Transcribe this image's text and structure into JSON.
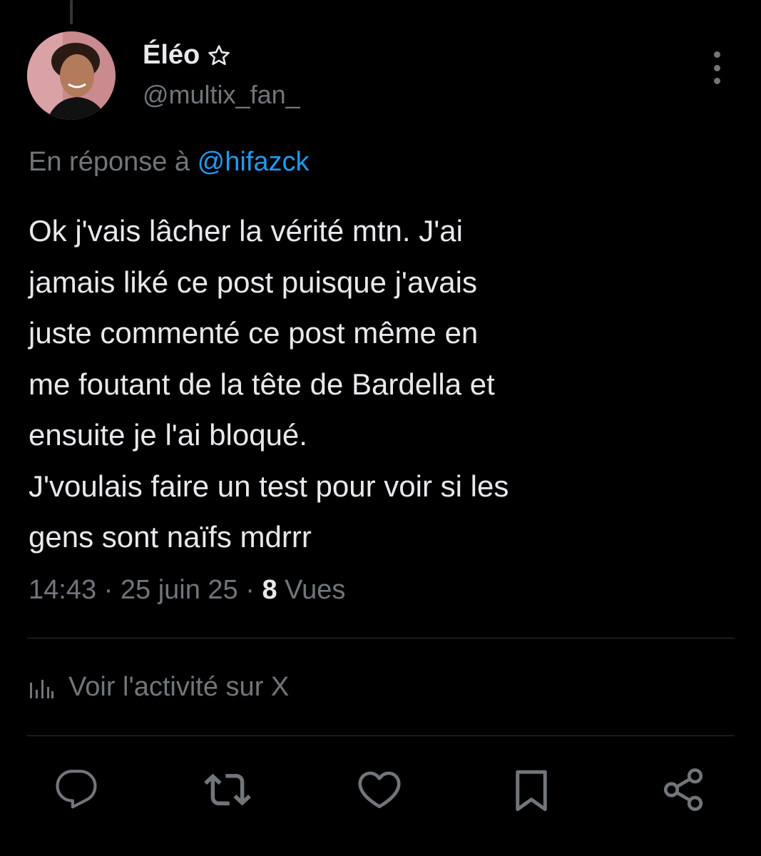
{
  "author": {
    "display_name": "Éléo",
    "handle": "@multix_fan_"
  },
  "reply_to": {
    "prefix": "En réponse à",
    "mention": "@hifazck"
  },
  "tweet": {
    "lines": [
      "Ok j'vais lâcher la vérité mtn. J'ai",
      "jamais liké ce post puisque j'avais",
      "juste commenté ce post même en",
      "me foutant de la tête de Bardella et",
      "ensuite je l'ai bloqué.",
      "J'voulais faire un test pour voir si les",
      "gens sont naïfs mdrrr"
    ]
  },
  "meta": {
    "time": "14:43",
    "sep": "·",
    "date": "25 juin 25",
    "views_count": "8",
    "views_label": "Vues"
  },
  "activity": {
    "label": "Voir l'activité sur X"
  },
  "actions": [
    "reply-icon",
    "retweet-icon",
    "like-icon",
    "bookmark-icon",
    "share-icon"
  ],
  "colors": {
    "background": "#000000",
    "text": "#e7e9ea",
    "secondary": "#71767b",
    "link": "#1d9bf0",
    "divider": "#2f3336"
  }
}
